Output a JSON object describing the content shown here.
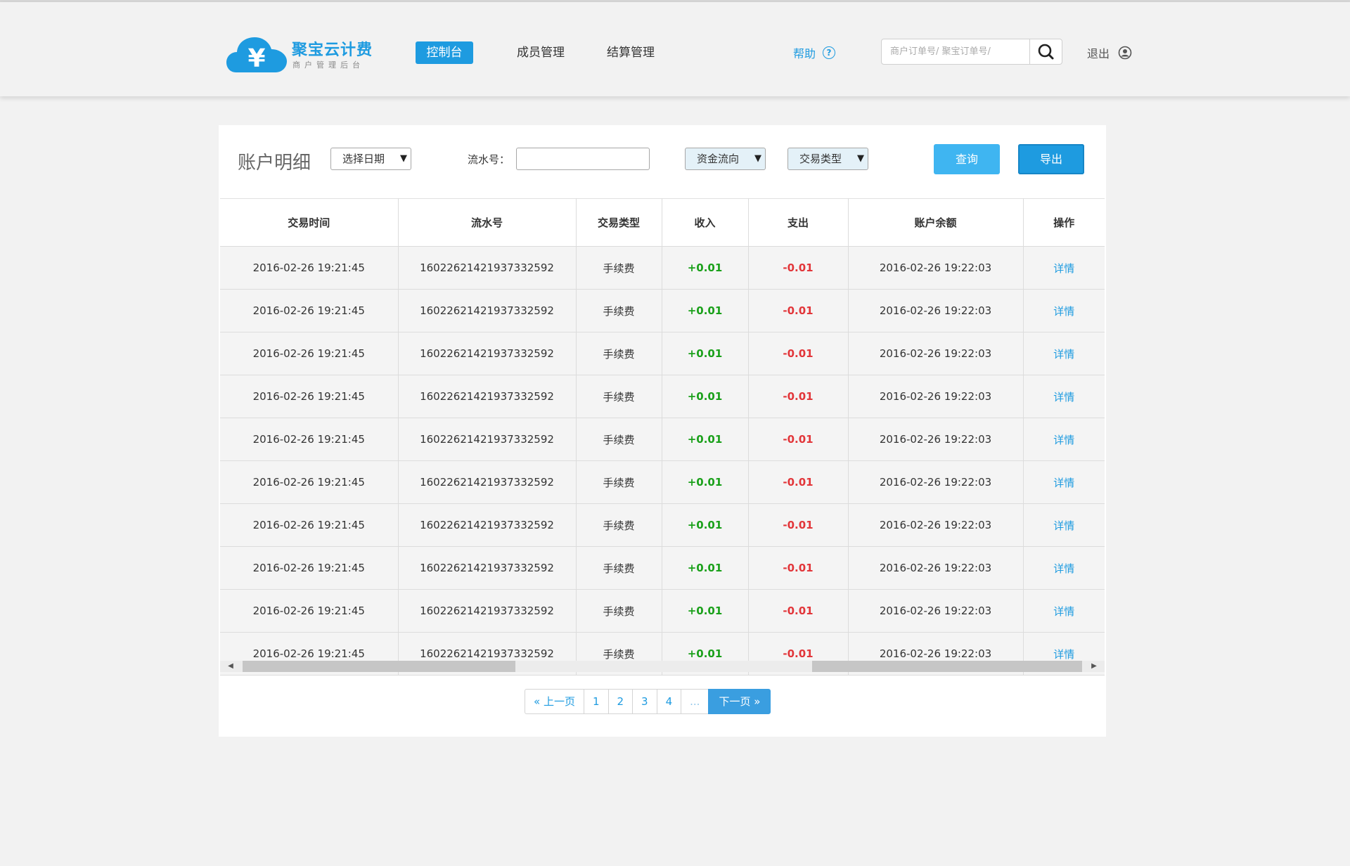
{
  "app": {
    "title": "聚宝云计费",
    "subtitle": "商户管理后台"
  },
  "colors": {
    "brand": "#1e9be0",
    "income": "#1aa01a",
    "expense": "#e2363a"
  },
  "nav": {
    "items": [
      {
        "label": "控制台",
        "active": true
      },
      {
        "label": "成员管理",
        "active": false
      },
      {
        "label": "结算管理",
        "active": false
      }
    ]
  },
  "header": {
    "help_label": "帮助",
    "help_icon": "question-circle-icon",
    "search_placeholder": "商户订单号/ 聚宝订单号/",
    "search_icon": "search-icon",
    "logout_label": "退出",
    "logout_icon": "user-icon"
  },
  "filters": {
    "page_title": "账户明细",
    "date_select": "选择日期",
    "serial_label": "流水号：",
    "serial_value": "",
    "flow_select": "资金流向",
    "type_select": "交易类型",
    "query_label": "查询",
    "export_label": "导出"
  },
  "table": {
    "columns": [
      "交易时间",
      "流水号",
      "交易类型",
      "收入",
      "支出",
      "账户余额",
      "操作"
    ],
    "rows": [
      [
        "2016-02-26 19:21:45",
        "16022621421937332592",
        "手续费",
        "+0.01",
        "-0.01",
        "2016-02-26 19:22:03",
        "详情"
      ],
      [
        "2016-02-26 19:21:45",
        "16022621421937332592",
        "手续费",
        "+0.01",
        "-0.01",
        "2016-02-26 19:22:03",
        "详情"
      ],
      [
        "2016-02-26 19:21:45",
        "16022621421937332592",
        "手续费",
        "+0.01",
        "-0.01",
        "2016-02-26 19:22:03",
        "详情"
      ],
      [
        "2016-02-26 19:21:45",
        "16022621421937332592",
        "手续费",
        "+0.01",
        "-0.01",
        "2016-02-26 19:22:03",
        "详情"
      ],
      [
        "2016-02-26 19:21:45",
        "16022621421937332592",
        "手续费",
        "+0.01",
        "-0.01",
        "2016-02-26 19:22:03",
        "详情"
      ],
      [
        "2016-02-26 19:21:45",
        "16022621421937332592",
        "手续费",
        "+0.01",
        "-0.01",
        "2016-02-26 19:22:03",
        "详情"
      ],
      [
        "2016-02-26 19:21:45",
        "16022621421937332592",
        "手续费",
        "+0.01",
        "-0.01",
        "2016-02-26 19:22:03",
        "详情"
      ],
      [
        "2016-02-26 19:21:45",
        "16022621421937332592",
        "手续费",
        "+0.01",
        "-0.01",
        "2016-02-26 19:22:03",
        "详情"
      ],
      [
        "2016-02-26 19:21:45",
        "16022621421937332592",
        "手续费",
        "+0.01",
        "-0.01",
        "2016-02-26 19:22:03",
        "详情"
      ],
      [
        "2016-02-26 19:21:45",
        "16022621421937332592",
        "手续费",
        "+0.01",
        "-0.01",
        "2016-02-26 19:22:03",
        "详情"
      ]
    ]
  },
  "pagination": {
    "prev_label": "« 上一页",
    "pages": [
      "1",
      "2",
      "3",
      "4",
      "..."
    ],
    "next_label": "下一页 »"
  }
}
